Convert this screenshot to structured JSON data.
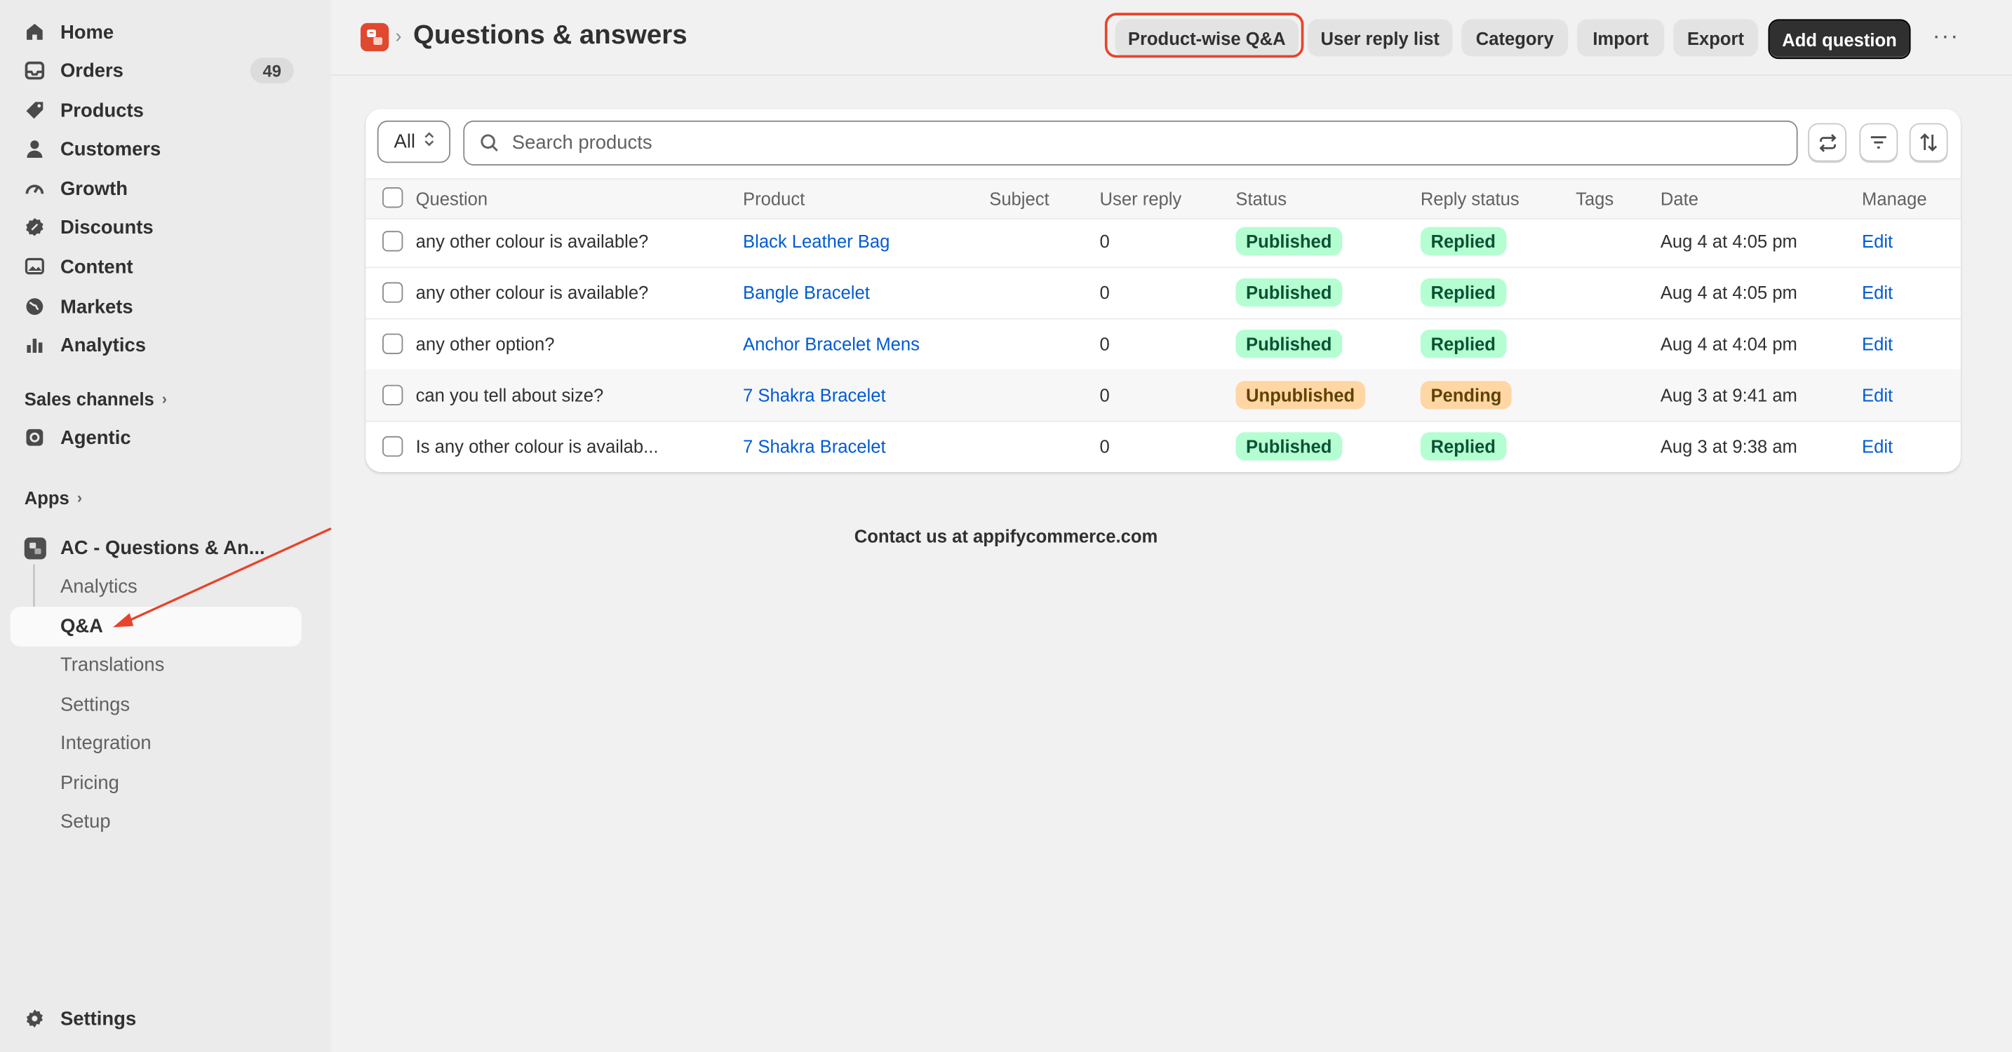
{
  "sidebar": {
    "nav": [
      {
        "label": "Home",
        "icon": "home-icon"
      },
      {
        "label": "Orders",
        "icon": "orders-icon",
        "badge": "49"
      },
      {
        "label": "Products",
        "icon": "tag-icon"
      },
      {
        "label": "Customers",
        "icon": "person-icon"
      },
      {
        "label": "Growth",
        "icon": "gauge-icon"
      },
      {
        "label": "Discounts",
        "icon": "discount-icon"
      },
      {
        "label": "Content",
        "icon": "image-icon"
      },
      {
        "label": "Markets",
        "icon": "globe-icon"
      },
      {
        "label": "Analytics",
        "icon": "bar-chart-icon"
      }
    ],
    "sales_channels_label": "Sales channels",
    "agentic_label": "Agentic",
    "apps_label": "Apps",
    "app_name": "AC - Questions & An...",
    "app_subitems": [
      "Analytics",
      "Q&A",
      "Translations",
      "Settings",
      "Integration",
      "Pricing",
      "Setup"
    ],
    "settings_label": "Settings"
  },
  "header": {
    "breadcrumb_sep": "›",
    "title": "Questions & answers",
    "buttons": [
      "Product-wise Q&A",
      "User reply list",
      "Category",
      "Import",
      "Export"
    ],
    "primary_button": "Add question",
    "more": "···"
  },
  "filters": {
    "select_value": "All",
    "search_placeholder": "Search products"
  },
  "table": {
    "columns": [
      "Question",
      "Product",
      "Subject",
      "User reply",
      "Status",
      "Reply status",
      "Tags",
      "Date",
      "Manage"
    ],
    "rows": [
      {
        "question": "any other colour is available?",
        "product": "Black Leather Bag",
        "subject": "",
        "user_reply": "0",
        "status": "Published",
        "reply_status": "Replied",
        "tags": "",
        "date": "Aug 4 at 4:05 pm",
        "manage": "Edit"
      },
      {
        "question": "any other colour is available?",
        "product": "Bangle Bracelet",
        "subject": "",
        "user_reply": "0",
        "status": "Published",
        "reply_status": "Replied",
        "tags": "",
        "date": "Aug 4 at 4:05 pm",
        "manage": "Edit"
      },
      {
        "question": "any other option?",
        "product": "Anchor Bracelet Mens",
        "subject": "",
        "user_reply": "0",
        "status": "Published",
        "reply_status": "Replied",
        "tags": "",
        "date": "Aug 4 at 4:04 pm",
        "manage": "Edit"
      },
      {
        "question": "can you tell about size?",
        "product": "7 Shakra Bracelet",
        "subject": "",
        "user_reply": "0",
        "status": "Unpublished",
        "reply_status": "Pending",
        "tags": "",
        "date": "Aug 3 at 9:41 am",
        "manage": "Edit"
      },
      {
        "question": "Is any other colour is availab...",
        "product": "7 Shakra Bracelet",
        "subject": "",
        "user_reply": "0",
        "status": "Published",
        "reply_status": "Replied",
        "tags": "",
        "date": "Aug 3 at 9:38 am",
        "manage": "Edit"
      }
    ]
  },
  "footer": {
    "contact": "Contact us at appifycommerce.com"
  },
  "colors": {
    "accent_annotation": "#e8432c",
    "link": "#005bd3",
    "published_bg": "#b4fed2",
    "pending_bg": "#ffd6a4"
  }
}
